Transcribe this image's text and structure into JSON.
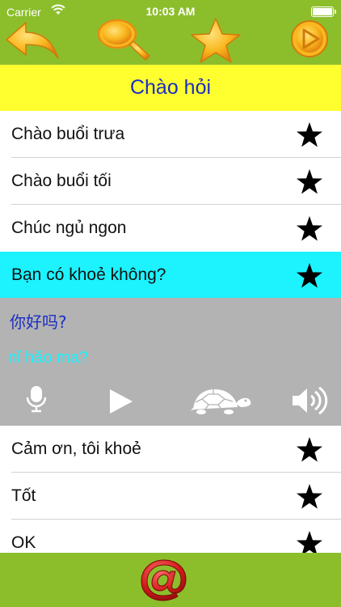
{
  "status_bar": {
    "carrier": "Carrier",
    "time": "10:03 AM"
  },
  "toolbar": {
    "icons": [
      "back-arrow-icon",
      "search-icon",
      "favorite-star-icon",
      "play-icon"
    ]
  },
  "title": "Chào hỏi",
  "rows_top": [
    {
      "label": "Chào buổi trưa"
    },
    {
      "label": "Chào buổi tối"
    },
    {
      "label": "Chúc ngủ ngon"
    }
  ],
  "selected_row": {
    "label": "Bạn có khoẻ không?"
  },
  "expanded": {
    "chinese": "你好吗?",
    "pinyin": "nǐ hǎo ma?",
    "controls": [
      "microphone-icon",
      "play-icon",
      "turtle-slow-icon",
      "speaker-icon"
    ]
  },
  "rows_bottom": [
    {
      "label": "Cảm ơn, tôi khoẻ"
    },
    {
      "label": "Tốt"
    },
    {
      "label": "OK"
    }
  ],
  "bottom_bar": {
    "icon": "at-sign-icon"
  },
  "colors": {
    "green": "#8cbe2c",
    "yellow": "#ffff2f",
    "title_text": "#1b2ec2",
    "selected": "#1cf3ff",
    "panel": "#b3b3b3",
    "orange": "#f7a11a"
  }
}
